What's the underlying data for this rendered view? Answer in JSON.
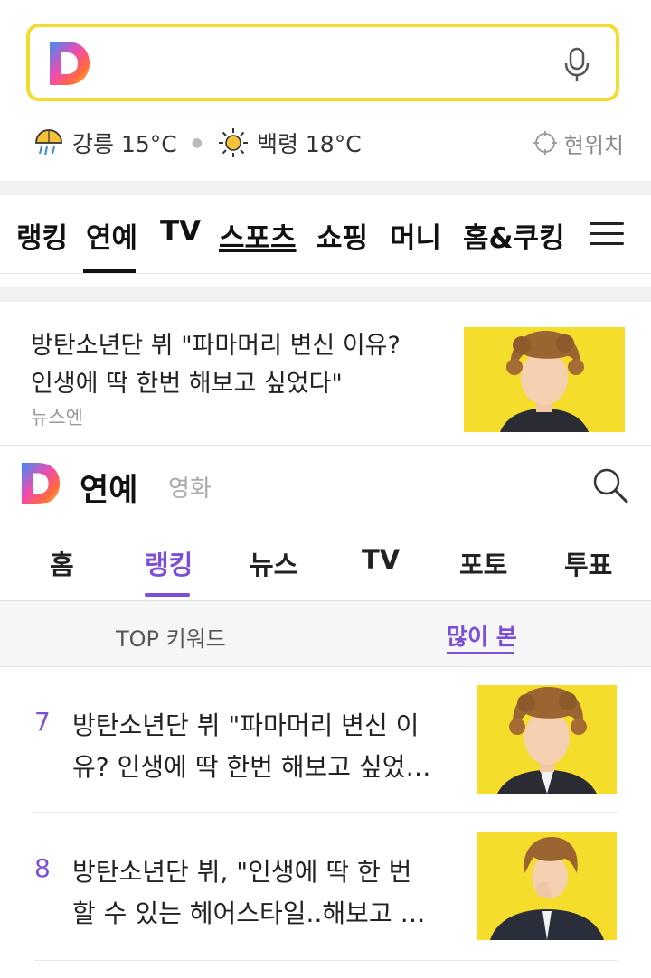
{
  "search": {
    "placeholder": ""
  },
  "weather": [
    {
      "icon": "rain-umbrella-icon",
      "text": "강릉 15°C"
    },
    {
      "icon": "sun-icon",
      "text": "백령 18°C"
    }
  ],
  "location": {
    "label": "현위치"
  },
  "category_nav": [
    "랭킹",
    "연예",
    "TV",
    "스포츠",
    "쇼핑",
    "머니",
    "홈&쿠킹"
  ],
  "top_article": {
    "title": "방탄소년단 뷔 \"파마머리 변신 이유? 인생에 딱 한번 해보고 싶었다\"",
    "source": "뉴스엔"
  },
  "section": {
    "title": "연예",
    "subtitle": "영화"
  },
  "sub_tabs": [
    "홈",
    "랭킹",
    "뉴스",
    "TV",
    "포토",
    "투표"
  ],
  "ranking_tabs": {
    "keyword": "TOP 키워드",
    "most_viewed": "많이 본"
  },
  "list": [
    {
      "rank": "7",
      "title": "방탄소년단 뷔 \"파마머리 변신 이유? 인생에 딱 한번 해보고 싶었…"
    },
    {
      "rank": "8",
      "title": "방탄소년단 뷔, \"인생에 딱 한 번 할 수 있는 헤어스타일..해보고 …"
    }
  ],
  "colors": {
    "accent": "#7d4ed8",
    "search_border": "#f1dd2f",
    "thumb_bg": "#f5dd2b"
  }
}
